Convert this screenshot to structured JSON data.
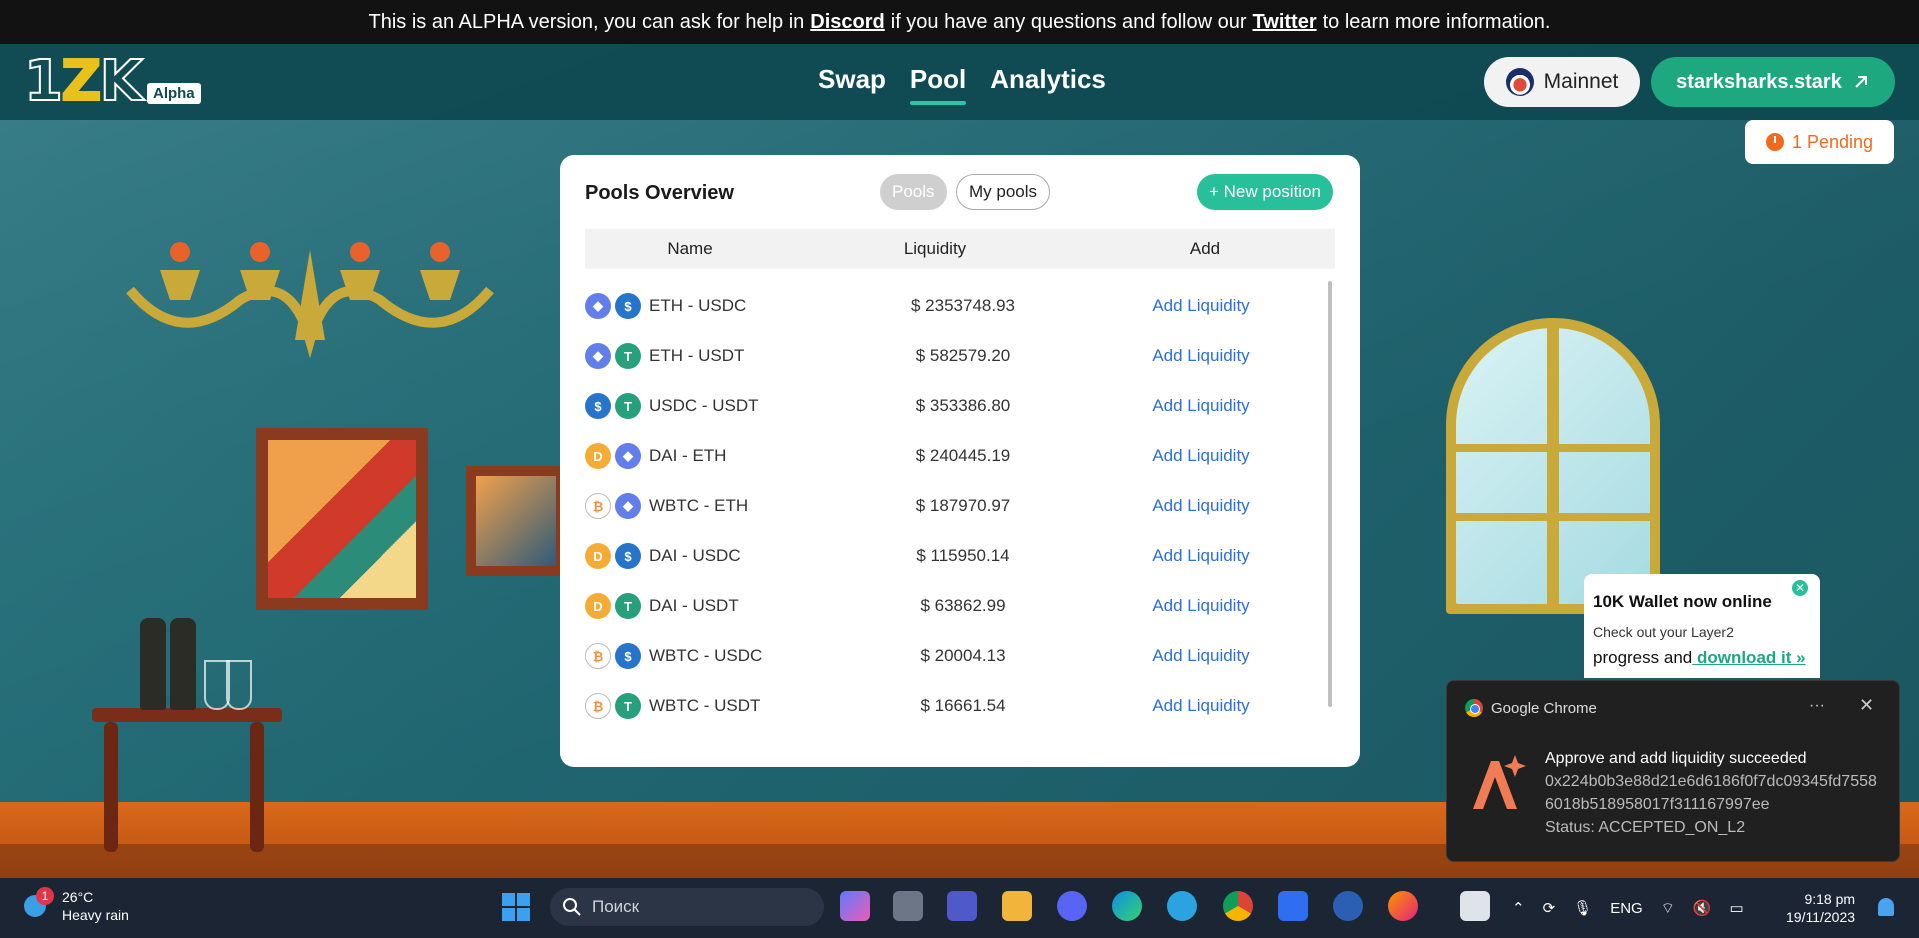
{
  "banner": {
    "text_before": "This is an ALPHA version, you can ask for help in",
    "discord": "Discord",
    "text_mid": "if you have any questions and follow our",
    "twitter": "Twitter",
    "text_after": "to learn more information."
  },
  "header": {
    "logo_text": "10K",
    "alpha_badge": "Alpha",
    "nav": [
      {
        "label": "Swap",
        "active": false
      },
      {
        "label": "Pool",
        "active": true
      },
      {
        "label": "Analytics",
        "active": false
      }
    ],
    "network": "Mainnet",
    "wallet": "starksharks.stark",
    "pending": "1 Pending"
  },
  "pools": {
    "title": "Pools Overview",
    "tab_pools": "Pools",
    "tab_my_pools": "My pools",
    "new_position": "+ New position",
    "columns": [
      "Name",
      "Liquidity",
      "Add"
    ],
    "rows": [
      {
        "tokens": [
          "eth",
          "usdc"
        ],
        "pair": "ETH - USDC",
        "liquidity": "$ 2353748.93",
        "action": "Add Liquidity"
      },
      {
        "tokens": [
          "eth",
          "usdt"
        ],
        "pair": "ETH - USDT",
        "liquidity": "$ 582579.20",
        "action": "Add Liquidity"
      },
      {
        "tokens": [
          "usdc",
          "usdt"
        ],
        "pair": "USDC - USDT",
        "liquidity": "$ 353386.80",
        "action": "Add Liquidity"
      },
      {
        "tokens": [
          "dai",
          "eth"
        ],
        "pair": "DAI - ETH",
        "liquidity": "$ 240445.19",
        "action": "Add Liquidity"
      },
      {
        "tokens": [
          "wbtc",
          "eth"
        ],
        "pair": "WBTC - ETH",
        "liquidity": "$ 187970.97",
        "action": "Add Liquidity"
      },
      {
        "tokens": [
          "dai",
          "usdc"
        ],
        "pair": "DAI - USDC",
        "liquidity": "$ 115950.14",
        "action": "Add Liquidity"
      },
      {
        "tokens": [
          "dai",
          "usdt"
        ],
        "pair": "DAI - USDT",
        "liquidity": "$ 63862.99",
        "action": "Add Liquidity"
      },
      {
        "tokens": [
          "wbtc",
          "usdc"
        ],
        "pair": "WBTC - USDC",
        "liquidity": "$ 20004.13",
        "action": "Add Liquidity"
      },
      {
        "tokens": [
          "wbtc",
          "usdt"
        ],
        "pair": "WBTC - USDT",
        "liquidity": "$ 16661.54",
        "action": "Add Liquidity"
      }
    ]
  },
  "promo": {
    "title": "10K Wallet now online",
    "subtitle": "Check out your Layer2",
    "line": "progress and",
    "link": " download it »"
  },
  "notification": {
    "app": "Google Chrome",
    "title": "Approve and add liquidity succeeded",
    "hash": "0x224b0b3e88d21e6d6186f0f7dc09345fd75586018b518958017f311167997ee",
    "status": "Status: ACCEPTED_ON_L2"
  },
  "taskbar": {
    "weather_badge": "1",
    "temperature": "26°C",
    "condition": "Heavy rain",
    "search_placeholder": "Поиск",
    "lang": "ENG",
    "time": "9:18 pm",
    "date": "19/11/2023"
  },
  "colors": {
    "accent": "#27c09a",
    "link": "#2a6fdb",
    "pending": "#f06a1d",
    "banner_bg": "#121212"
  }
}
